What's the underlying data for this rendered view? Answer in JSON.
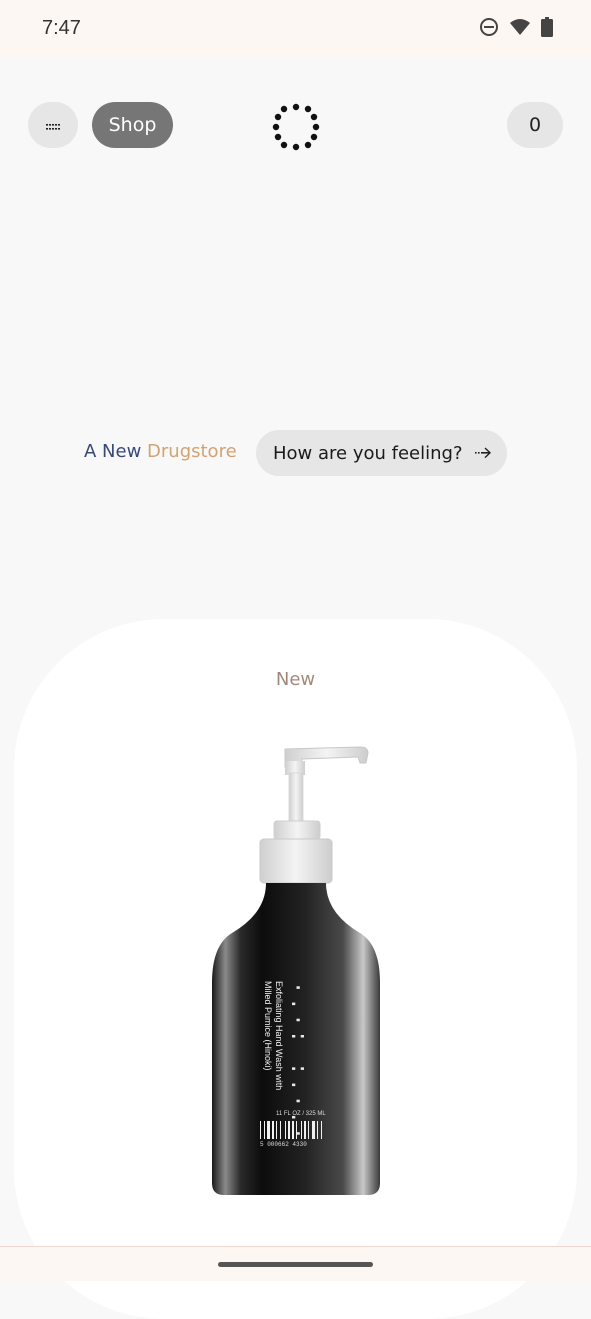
{
  "status_bar": {
    "time": "7:47",
    "icons": [
      "do-not-disturb-icon",
      "wifi-icon",
      "battery-icon"
    ]
  },
  "header": {
    "menu_icon": "menu-icon",
    "shop_label": "Shop",
    "logo_icon": "dotted-ring-logo",
    "cart_count": "0"
  },
  "hero": {
    "tagline_part1": "A New ",
    "tagline_part2": "Drugstore",
    "feeling_button_label": "How are you feeling?",
    "feeling_button_icon": "arrow-right-icon"
  },
  "product_card": {
    "badge": "New",
    "product_label": "Exfoliating Hand Wash with Milled Pumice (Hinoki)",
    "product_size": "11 FL OZ / 325 ML",
    "barcode_number": "5 000662 4330"
  },
  "colors": {
    "tagline_blue": "#3a4a78",
    "tagline_gold": "#d3a273",
    "shop_button": "#767676",
    "pill_gray": "#e6e6e6"
  }
}
